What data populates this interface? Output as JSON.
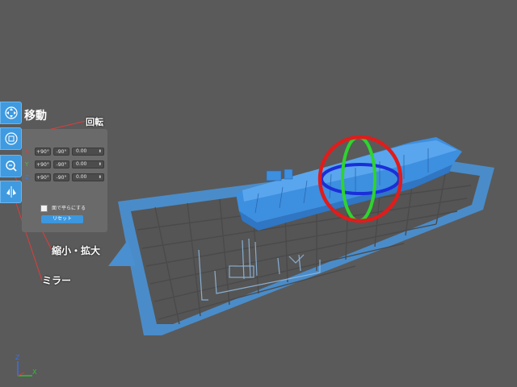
{
  "toolbar": {
    "buttons": [
      {
        "name": "move",
        "icon": "move-icon"
      },
      {
        "name": "rotate",
        "icon": "rotate-icon"
      },
      {
        "name": "scale",
        "icon": "zoom-icon"
      },
      {
        "name": "mirror",
        "icon": "mirror-icon"
      }
    ]
  },
  "rotate_panel": {
    "axes": [
      {
        "label": "X",
        "color": "#e03c3c",
        "plus": "+90°",
        "minus": "-90°",
        "value": "0.00"
      },
      {
        "label": "Y",
        "color": "#3cc83c",
        "plus": "+90°",
        "minus": "-90°",
        "value": "0.00"
      },
      {
        "label": "Z",
        "color": "#3c78e8",
        "plus": "+90°",
        "minus": "-90°",
        "value": "0.00"
      }
    ],
    "flat_label": "面で平らにする",
    "reset_label": "リセット"
  },
  "callouts": {
    "move": "移動",
    "rotate": "回転",
    "scale": "縮小・拡大",
    "mirror": "ミラー"
  },
  "axis_gizmo": {
    "x_label": "X",
    "z_label": "Z",
    "x_color": "#29c429",
    "z_color": "#3a70e8"
  },
  "colors": {
    "background": "#5a5a5a",
    "build_plate": "#4694d8",
    "model": "#3d8fe0",
    "accent": "#3f9ae0"
  }
}
